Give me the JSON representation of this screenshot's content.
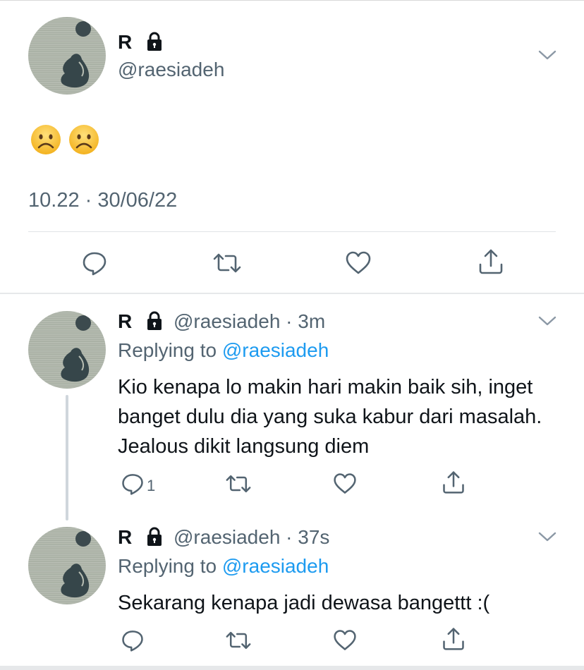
{
  "main_tweet": {
    "name": "R",
    "handle": "@raesiadeh",
    "emojis": [
      "frowning-face",
      "frowning-face"
    ],
    "timestamp": "10.22 · 30/06/22"
  },
  "replies": [
    {
      "name": "R",
      "handle_time": "@raesiadeh · 3m",
      "replying_prefix": "Replying to ",
      "replying_to": "@raesiadeh",
      "text": "Kio kenapa lo makin hari makin baik sih, inget banget dulu dia yang suka kabur dari masalah. Jealous dikit langsung diem",
      "reply_count": "1"
    },
    {
      "name": "R",
      "handle_time": "@raesiadeh · 37s",
      "replying_prefix": "Replying to ",
      "replying_to": "@raesiadeh",
      "text": "Sekarang kenapa jadi dewasa bangettt :(",
      "reply_count": ""
    }
  ],
  "colors": {
    "link": "#1d9bf0",
    "secondary_text": "#536471",
    "primary_text": "#0f1419",
    "icon": "#536471"
  }
}
